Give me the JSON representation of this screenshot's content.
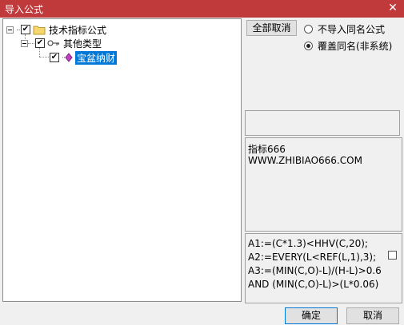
{
  "window": {
    "title": "导入公式",
    "close_glyph": "✕"
  },
  "tree": {
    "root": {
      "label": "技术指标公式",
      "checked": true,
      "check_glyph": "✔",
      "expander": "minus"
    },
    "group": {
      "label": "其他类型",
      "checked": true,
      "check_glyph": "✔",
      "expander": "minus"
    },
    "item": {
      "label": "宝盆纳财",
      "checked": true,
      "check_glyph": "✔",
      "selected": true
    }
  },
  "controls": {
    "cancel_all_label": "全部取消",
    "radio_no_import": "不导入同名公式",
    "radio_overwrite": "覆盖同名(非系统)",
    "selected_radio": "overwrite"
  },
  "info": {
    "line1": "指标666",
    "line2": "WWW.ZHIBIAO666.COM"
  },
  "code": {
    "lines": [
      "A1:=(C*1.3)<HHV(C,20);",
      "A2:=EVERY(L<REF(L,1),3);",
      "A3:=(MIN(C,O)-L)/(H-L)>0.6",
      "AND (MIN(C,O)-L)>(L*0.06)"
    ]
  },
  "footer": {
    "ok_label": "确定",
    "cancel_label": "取消"
  },
  "colors": {
    "titlebar": "#c0393b",
    "selection": "#0078d7"
  }
}
